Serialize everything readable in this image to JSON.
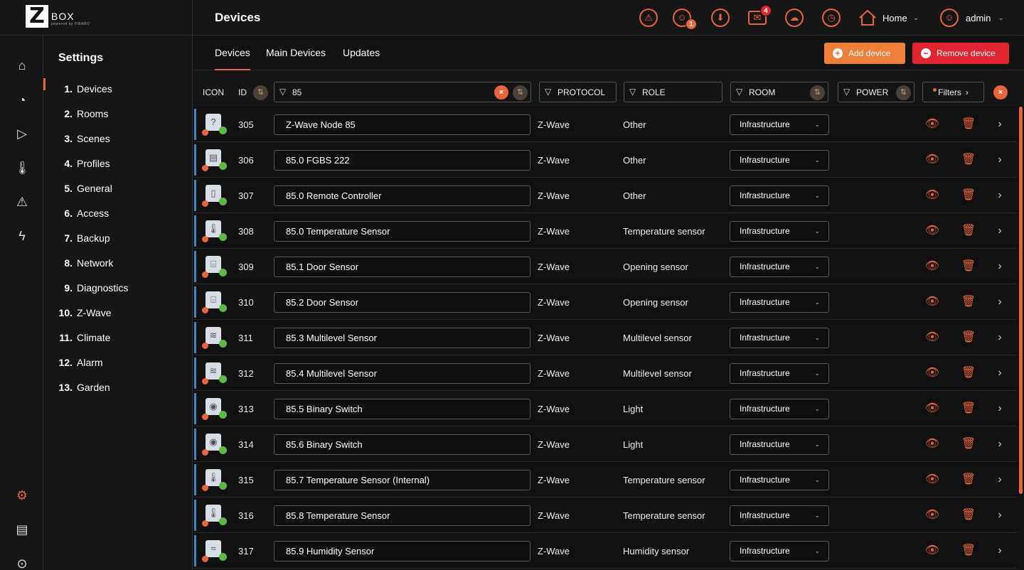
{
  "brand": {
    "logo_letter": "Z",
    "logo_text": "BOX",
    "logo_sub": "powered by FIBARO"
  },
  "header": {
    "title": "Devices",
    "home_label": "Home",
    "user_label": "admin",
    "badges": {
      "users": "1",
      "messages": "4"
    }
  },
  "settings": {
    "title": "Settings",
    "items": [
      {
        "num": "1.",
        "label": "Devices"
      },
      {
        "num": "2.",
        "label": "Rooms"
      },
      {
        "num": "3.",
        "label": "Scenes"
      },
      {
        "num": "4.",
        "label": "Profiles"
      },
      {
        "num": "5.",
        "label": "General"
      },
      {
        "num": "6.",
        "label": "Access"
      },
      {
        "num": "7.",
        "label": "Backup"
      },
      {
        "num": "8.",
        "label": "Network"
      },
      {
        "num": "9.",
        "label": "Diagnostics"
      },
      {
        "num": "10.",
        "label": "Z-Wave"
      },
      {
        "num": "11.",
        "label": "Climate"
      },
      {
        "num": "12.",
        "label": "Alarm"
      },
      {
        "num": "13.",
        "label": "Garden"
      }
    ]
  },
  "tabs": [
    "Devices",
    "Main Devices",
    "Updates"
  ],
  "buttons": {
    "add": "Add device",
    "remove": "Remove device",
    "filters": "Filters"
  },
  "filters": {
    "icon_label": "ICON",
    "id_label": "ID",
    "name_value": "85",
    "protocol_label": "PROTOCOL",
    "role_label": "ROLE",
    "room_label": "ROOM",
    "power_label": "POWER"
  },
  "devices": [
    {
      "id": "305",
      "name": "Z-Wave Node 85",
      "protocol": "Z-Wave",
      "role": "Other",
      "room": "Infrastructure",
      "icon": "unknown-device-icon"
    },
    {
      "id": "306",
      "name": "85.0 FGBS 222",
      "protocol": "Z-Wave",
      "role": "Other",
      "room": "Infrastructure",
      "icon": "module-icon"
    },
    {
      "id": "307",
      "name": "85.0 Remote Controller",
      "protocol": "Z-Wave",
      "role": "Other",
      "room": "Infrastructure",
      "icon": "remote-icon"
    },
    {
      "id": "308",
      "name": "85.0 Temperature Sensor",
      "protocol": "Z-Wave",
      "role": "Temperature sensor",
      "room": "Infrastructure",
      "icon": "thermometer-icon"
    },
    {
      "id": "309",
      "name": "85.1 Door Sensor",
      "protocol": "Z-Wave",
      "role": "Opening sensor",
      "room": "Infrastructure",
      "icon": "door-icon"
    },
    {
      "id": "310",
      "name": "85.2 Door Sensor",
      "protocol": "Z-Wave",
      "role": "Opening sensor",
      "room": "Infrastructure",
      "icon": "door-icon"
    },
    {
      "id": "311",
      "name": "85.3 Multilevel Sensor",
      "protocol": "Z-Wave",
      "role": "Multilevel sensor",
      "room": "Infrastructure",
      "icon": "multilevel-icon"
    },
    {
      "id": "312",
      "name": "85.4 Multilevel Sensor",
      "protocol": "Z-Wave",
      "role": "Multilevel sensor",
      "room": "Infrastructure",
      "icon": "multilevel-icon"
    },
    {
      "id": "313",
      "name": "85.5 Binary Switch",
      "protocol": "Z-Wave",
      "role": "Light",
      "room": "Infrastructure",
      "icon": "bulb-icon"
    },
    {
      "id": "314",
      "name": "85.6 Binary Switch",
      "protocol": "Z-Wave",
      "role": "Light",
      "room": "Infrastructure",
      "icon": "bulb-icon"
    },
    {
      "id": "315",
      "name": "85.7 Temperature Sensor (Internal)",
      "protocol": "Z-Wave",
      "role": "Temperature sensor",
      "room": "Infrastructure",
      "icon": "thermometer-icon"
    },
    {
      "id": "316",
      "name": "85.8 Temperature Sensor",
      "protocol": "Z-Wave",
      "role": "Temperature sensor",
      "room": "Infrastructure",
      "icon": "thermometer-icon"
    },
    {
      "id": "317",
      "name": "85.9 Humidity Sensor",
      "protocol": "Z-Wave",
      "role": "Humidity sensor",
      "room": "Infrastructure",
      "icon": "humidity-icon"
    }
  ],
  "colors": {
    "accent": "#e8643a",
    "danger": "#e02530",
    "row_bar": "#3d86c6",
    "ok": "#5db84a"
  }
}
